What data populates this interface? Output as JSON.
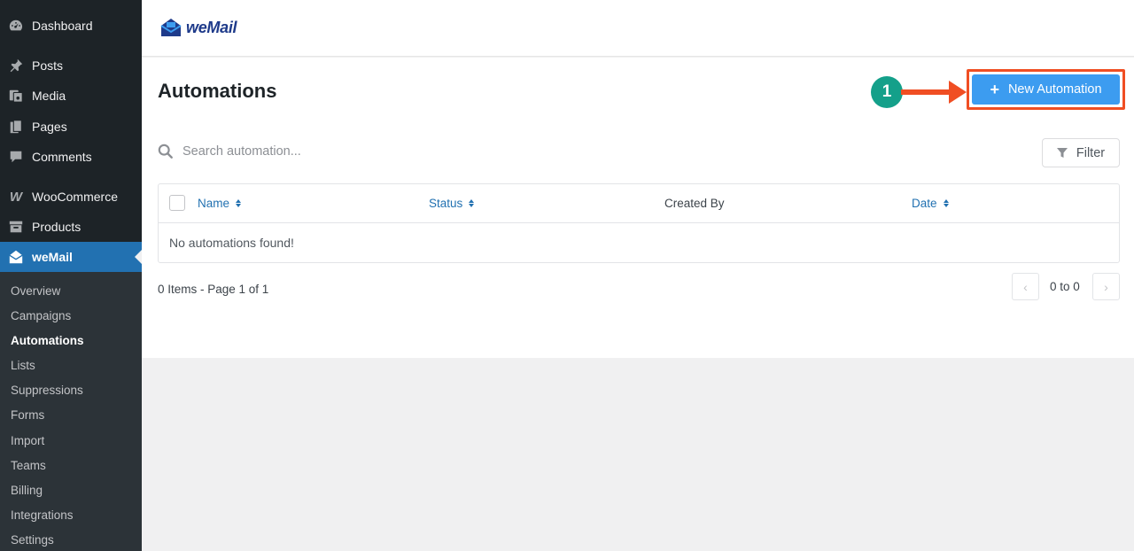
{
  "sidebar": {
    "menu": [
      {
        "label": "Dashboard",
        "icon": "dashboard-icon"
      },
      {
        "label": "Posts",
        "icon": "pin-icon"
      },
      {
        "label": "Media",
        "icon": "media-icon"
      },
      {
        "label": "Pages",
        "icon": "pages-icon"
      },
      {
        "label": "Comments",
        "icon": "comment-icon"
      },
      {
        "label": "WooCommerce",
        "icon": "woocommerce-icon"
      },
      {
        "label": "Products",
        "icon": "archive-icon"
      },
      {
        "label": "weMail",
        "icon": "envelope-icon"
      }
    ],
    "submenu": [
      "Overview",
      "Campaigns",
      "Automations",
      "Lists",
      "Suppressions",
      "Forms",
      "Import",
      "Teams",
      "Billing",
      "Integrations",
      "Settings"
    ],
    "current_submenu": "Automations"
  },
  "brand": {
    "name": "weMail",
    "color": "#1e3a8a"
  },
  "page": {
    "title": "Automations",
    "new_button": "New Automation",
    "step_number": "1",
    "search_placeholder": "Search automation...",
    "filter_label": "Filter"
  },
  "table": {
    "columns": [
      {
        "label": "Name",
        "sortable": true
      },
      {
        "label": "Status",
        "sortable": true
      },
      {
        "label": "Created By",
        "sortable": false
      },
      {
        "label": "Date",
        "sortable": true
      }
    ],
    "empty_message": "No automations found!"
  },
  "pagination": {
    "summary": "0 Items - Page 1 of 1",
    "range": "0 to 0",
    "prev": "‹",
    "next": "›"
  },
  "colors": {
    "accent": "#2271b1",
    "primary_button": "#3c9cf0",
    "highlight": "#f04e23",
    "step_badge": "#14a08a"
  }
}
